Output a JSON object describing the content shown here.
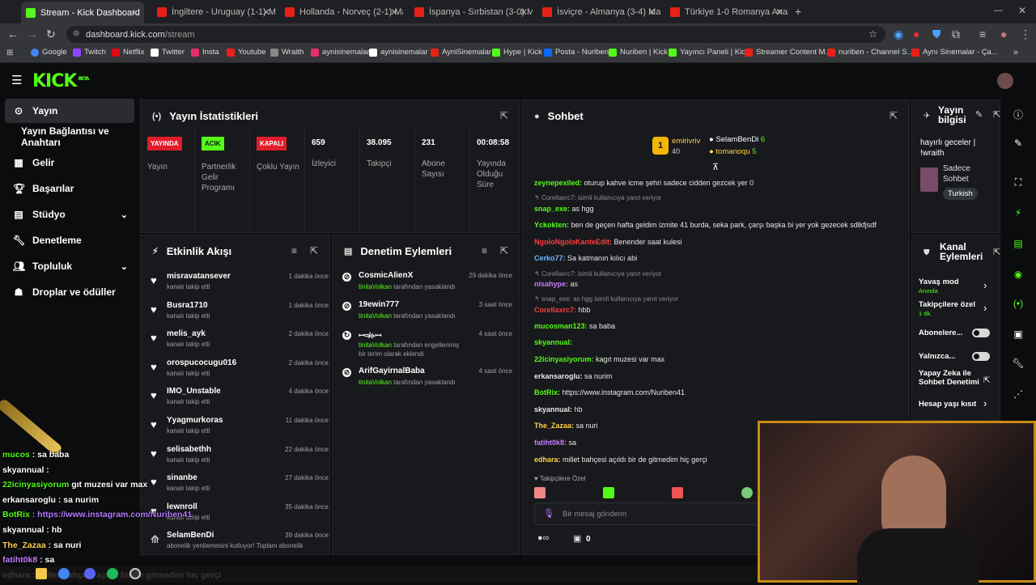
{
  "browser": {
    "tabs": [
      {
        "title": "Stream - Kick Dashboard"
      },
      {
        "title": "İngiltere - Uruguay (1-1) Maç Ö"
      },
      {
        "title": "Hollanda - Norveç (2-1) Maç Ö"
      },
      {
        "title": "İspanya - Sırbistan (3-0) Maç Ö"
      },
      {
        "title": "İsviçre - Almanya (3-4) Maç Özet"
      },
      {
        "title": "Türkiye 1-0 Romanya Analizi -"
      }
    ],
    "url_host": "dashboard.kick.com",
    "url_path": "/stream",
    "bookmarks": [
      "Google",
      "Twitch",
      "Netflix",
      "Twitter",
      "Insta",
      "Youtube",
      "Wraith",
      "aynisinemalar",
      "aynisinemalar",
      "AyniSinemalar",
      "Hype | Kick",
      "Posta - Nuriben",
      "Nuriben | Kick",
      "Yayıncı Paneli | Kick",
      "Streamer Content M...",
      "nuriben - Channel S...",
      "Aynı Sinemalar - Ça..."
    ]
  },
  "logo": {
    "text": "KICK",
    "sup": "BETA"
  },
  "sidebar": {
    "items": [
      {
        "label": "Yayın"
      },
      {
        "label": "Yayın Bağlantısı ve Anahtarı"
      },
      {
        "label": "Gelir"
      },
      {
        "label": "Başarılar"
      },
      {
        "label": "Stüdyo"
      },
      {
        "label": "Denetleme"
      },
      {
        "label": "Topluluk"
      },
      {
        "label": "Droplar ve ödüller"
      }
    ]
  },
  "stats_panel": {
    "title": "Yayın İstatistikleri",
    "stats": [
      {
        "badge": "YAYINDA",
        "label": "Yayın"
      },
      {
        "badge": "ACIK",
        "label": "Partnerlik Gelir Programı"
      },
      {
        "badge": "KAPALI",
        "label": "Çoklu Yayın"
      },
      {
        "value": "659",
        "label": "İzleyici"
      },
      {
        "value": "38.095",
        "label": "Takipçi"
      },
      {
        "value": "231",
        "label": "Abone Sayısı"
      },
      {
        "value": "00:08:58",
        "label": "Yayında Olduğu Süre"
      }
    ]
  },
  "activity_panel": {
    "title": "Etkinlik Akışı",
    "events": [
      {
        "name": "misravatansever",
        "sub": "kanalı takip etti",
        "time": "1 dakika önce"
      },
      {
        "name": "Busra1710",
        "sub": "kanalı takip etti",
        "time": "1 dakika önce"
      },
      {
        "name": "melis_ayk",
        "sub": "kanalı takip etti",
        "time": "2 dakika önce"
      },
      {
        "name": "orospucocugu016",
        "sub": "kanalı takip etti",
        "time": "2 dakika önce"
      },
      {
        "name": "IMO_Unstable",
        "sub": "kanalı takip etti",
        "time": "4 dakika önce"
      },
      {
        "name": "Yyagmurkoras",
        "sub": "kanalı takip etti",
        "time": "11 dakika önce"
      },
      {
        "name": "selisabethh",
        "sub": "kanalı takip etti",
        "time": "22 dakika önce"
      },
      {
        "name": "sinanbe",
        "sub": "kanalı takip etti",
        "time": "27 dakika önce"
      },
      {
        "name": "lewnroll",
        "sub": "kanalı takip etti",
        "time": "35 dakika önce"
      },
      {
        "name": "SelamBenDi",
        "sub": "abonelik yenilemesini kutluyor! Toplam abonelik",
        "time": "39 dakika önce"
      }
    ]
  },
  "mod_panel": {
    "title": "Denetim Eylemleri",
    "actions": [
      {
        "name": "CosmicAlienX",
        "by": "tinitaVolkan",
        "rest": " tarafından yasaklandı",
        "time": "29 dakika önce"
      },
      {
        "name": "19ewin777",
        "by": "tinitaVolkan",
        "rest": " tarafından yasaklandı",
        "time": "3 saat önce"
      },
      {
        "name": "ꟷ≉⟡ꟷ",
        "by": "tinitaVolkan",
        "rest": " tarafından engellenmiş bir terim olarak eklendi",
        "time": "4 saat önce"
      },
      {
        "name": "ArifGayirnalBaba",
        "by": "tinitaVolkan",
        "rest": " tarafından yasaklandı",
        "time": "4 saat önce"
      }
    ]
  },
  "chat": {
    "title": "Sohbet",
    "top_gifters": [
      {
        "rank": "1",
        "name": "emirivriv",
        "count": "40"
      },
      {
        "name": "SelamBenDi",
        "count": "6"
      },
      {
        "name": "tomanoqu",
        "count": "5"
      }
    ],
    "messages": [
      {
        "user": "zeynepexiled",
        "color": "#53fc18",
        "text": "oturup kahve icme şehri sadece cidden gezcek yer 0"
      },
      {
        "reply": "Corellaxrc7: ",
        "reply_text": "isimli kullanıcıya yanıt veriyor"
      },
      {
        "user": "snap_exe",
        "color": "#53fc18",
        "text": "as hgg"
      },
      {
        "user": "Yckokten",
        "color": "#53fc18",
        "text": "ben de geçen hafta geldim izmite 41 burda, seka park, çarşı başka bi yer yok gezecek sdlkfjsdf"
      },
      {
        "user": "NgoloNgoloKanteEdit",
        "color": "#ff3c3c",
        "text": "Benender saat kulesi"
      },
      {
        "user": "Cerko77",
        "color": "#6ab7ff",
        "text": "Sa katmanın kılıcı abi"
      },
      {
        "reply": "Corellaxrc7: ",
        "reply_text": "isimli kullanıcıya yanıt veriyor"
      },
      {
        "user": "nisahype",
        "color": "#c77dff",
        "text": "as"
      },
      {
        "reply": "snap_exe: as hgg ",
        "reply_text": "isimli kullanıcıya yanıt veriyor"
      },
      {
        "user": "Corellaxrc7",
        "color": "#ff3c3c",
        "text": "hbb"
      },
      {
        "user": "mucosman123",
        "color": "#53fc18",
        "text": "sa baba"
      },
      {
        "user": "skyannual",
        "color": "#53fc18",
        "text": ""
      },
      {
        "user": "22icinyasiyorum",
        "color": "#53fc18",
        "text": "kagıt muzesi var max"
      },
      {
        "user": "erkansaroglu",
        "color": "#e8e8e8",
        "text": "sa nurim"
      },
      {
        "user": "BotRix",
        "color": "#53fc18",
        "text": "https://www.instagram.com/Nuriben41"
      },
      {
        "user": "skyannual",
        "color": "#e8e8e8",
        "text": "hb"
      },
      {
        "user": "The_Zazaa",
        "color": "#ffd24a",
        "text": "sa nuri"
      },
      {
        "user": "fatiht0k8",
        "color": "#c77dff",
        "text": "sa"
      },
      {
        "user": "edhara",
        "color": "#ffd24a",
        "text": "millet bahçesi açıldı bir de gitmedim hiç gerçi"
      }
    ],
    "followers_only": "Takipçilere Özel",
    "input_placeholder": "Bir mesaj gönderin",
    "footer_count": "0"
  },
  "stream_info": {
    "title": "Yayın bilgisi",
    "stream_title": "hayırlı geceler | !wraith",
    "category": "Sadece Sohbet",
    "tag": "Turkish"
  },
  "channel_actions": {
    "title": "Kanal Eylemleri",
    "rows": [
      {
        "label": "Yavaş mod",
        "sub": "Anında"
      },
      {
        "label": "Takipçilere özel",
        "sub": "1 dk."
      },
      {
        "label": "Abonelere..."
      },
      {
        "label": "Yalnızca..."
      },
      {
        "label": "Yapay Zeka ile Sohbet Denetimi"
      },
      {
        "label": "Hesap yaşı kısıt"
      }
    ]
  },
  "overlay_chat": [
    {
      "user": "mucos",
      "text": ": sa baba"
    },
    {
      "user": "skyannual",
      "text": ":"
    },
    {
      "user": "22icinyasiyorum",
      "text": "gıt muzesi var max"
    },
    {
      "user": "erkansaroglu",
      "text": ": sa nurim"
    },
    {
      "user": "BotRix",
      "text": ": https://www.instagram.com/Nuriben41"
    },
    {
      "user": "skyannual",
      "text": ": hb"
    },
    {
      "user": "The_Zazaa",
      "text": ": sa nuri"
    },
    {
      "user": "fatiht0k8",
      "text": ": sa"
    },
    {
      "user": "edhara",
      "text": ": millet bahçesi açıldı bir de gitmedim hiç gerçi"
    }
  ]
}
